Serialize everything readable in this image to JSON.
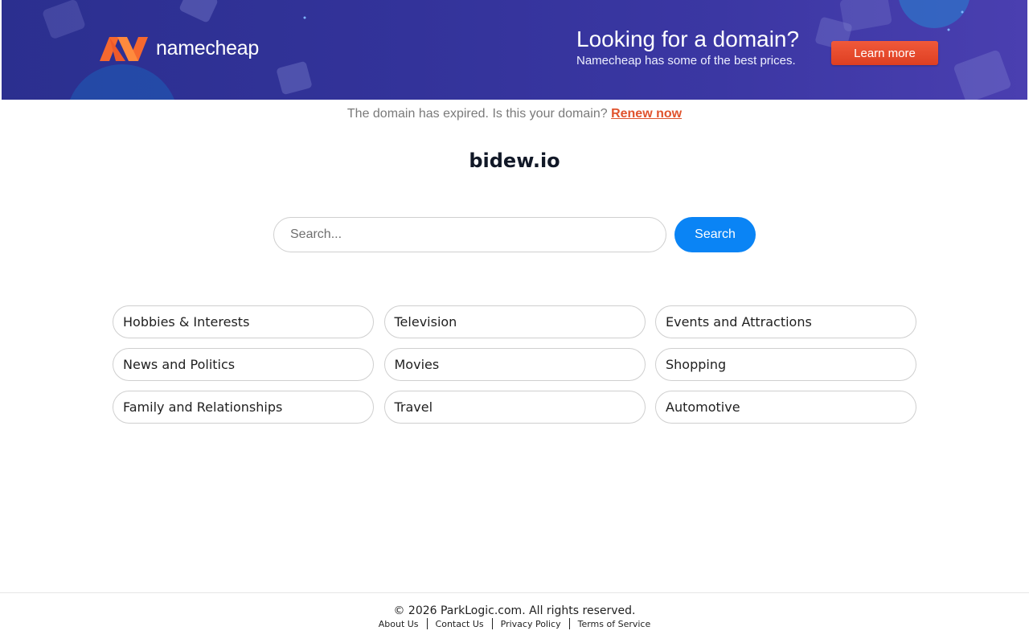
{
  "banner": {
    "brand": "namecheap",
    "title": "Looking for a domain?",
    "subtitle": "Namecheap has some of the best prices.",
    "cta_label": "Learn more",
    "accent_color": "#e8472a",
    "background_color": "#33339a"
  },
  "notice": {
    "text": "The domain has expired. Is this your domain?",
    "link_label": "Renew now",
    "link_color": "#e0532d"
  },
  "domain": {
    "name": "bidew.io"
  },
  "search": {
    "placeholder": "Search...",
    "button_label": "Search",
    "button_color": "#0a84f5"
  },
  "categories": [
    {
      "label": "Hobbies & Interests"
    },
    {
      "label": "Television"
    },
    {
      "label": "Events and Attractions"
    },
    {
      "label": "News and Politics"
    },
    {
      "label": "Movies"
    },
    {
      "label": "Shopping"
    },
    {
      "label": "Family and Relationships"
    },
    {
      "label": "Travel"
    },
    {
      "label": "Automotive"
    }
  ],
  "footer": {
    "copyright": "© 2026 ParkLogic.com. All rights reserved.",
    "links": [
      {
        "label": "About Us"
      },
      {
        "label": "Contact Us"
      },
      {
        "label": "Privacy Policy"
      },
      {
        "label": "Terms of Service"
      }
    ]
  }
}
